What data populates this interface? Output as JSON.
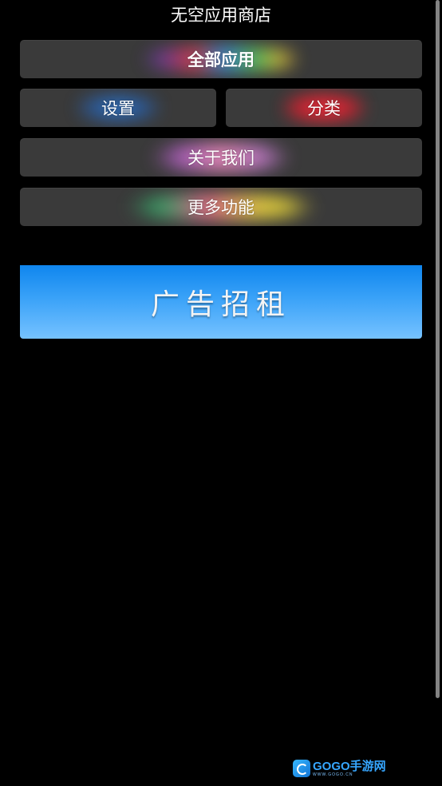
{
  "app": {
    "title": "无空应用商店"
  },
  "menu": {
    "all_apps": "全部应用",
    "settings": "设置",
    "category": "分类",
    "about": "关于我们",
    "more": "更多功能"
  },
  "ad": {
    "label": "广告招租",
    "color_top": "#0f86ee",
    "color_bottom": "#76c2ff"
  },
  "watermark": {
    "brand": "GOGO手游网",
    "url": "WWW.GOGO.CN"
  },
  "colors": {
    "background": "#000000",
    "button": "#3a3a3a",
    "text": "#ffffff"
  }
}
